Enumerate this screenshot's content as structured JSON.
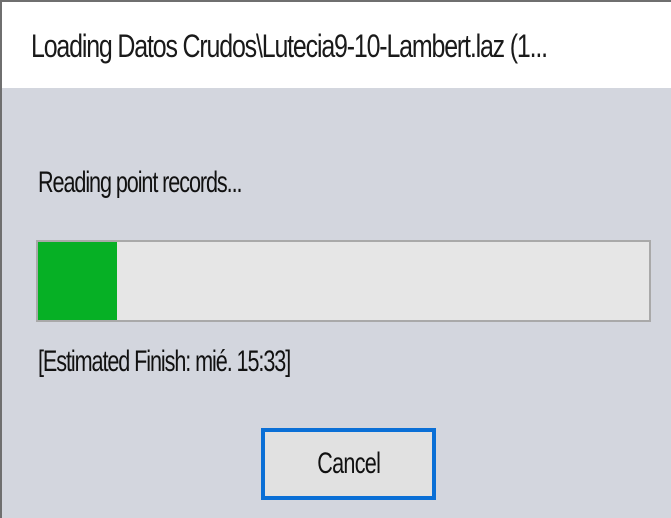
{
  "window": {
    "title": "Loading Datos Crudos\\Lutecia9-10-Lambert.laz (1..."
  },
  "status_text": "Reading point records...",
  "progress": {
    "percent": 13,
    "fill_color": "#06b025"
  },
  "estimate_text": "[Estimated Finish: mié. 15:33]",
  "buttons": {
    "cancel_label": "Cancel"
  }
}
